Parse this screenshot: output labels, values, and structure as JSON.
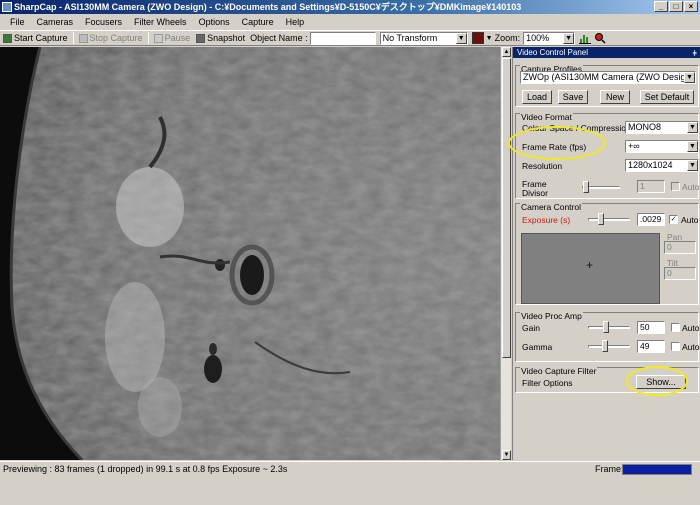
{
  "window": {
    "title": "SharpCap - ASI130MM Camera (ZWO Design) - C:¥Documents and Settings¥D-5150C¥デスクトップ¥DMKimage¥140103",
    "min": "_",
    "max": "□",
    "close": "×"
  },
  "menu": [
    "File",
    "Cameras",
    "Focusers",
    "Filter Wheels",
    "Options",
    "Capture",
    "Help"
  ],
  "toolbar": {
    "start_capture": "Start Capture",
    "stop_capture": "Stop Capture",
    "pause": "Pause",
    "snapshot": "Snapshot",
    "object_name_label": "Object Name :",
    "object_name_value": "",
    "transform_value": "No Transform",
    "zoom_label": "Zoom:",
    "zoom_value": "100%"
  },
  "panel": {
    "title": "Video Control Panel",
    "pin": "ǂ",
    "capture_profiles": {
      "label": "Capture Profiles",
      "profile": "ZWOp (ASI130MM Camera (ZWO Design))",
      "load": "Load",
      "save": "Save",
      "new": "New",
      "set_default": "Set Default"
    },
    "video_format": {
      "label": "Video Format",
      "colour_space_label": "Colour Space / Compression",
      "colour_space_value": "MONO8",
      "frame_rate_label": "Frame Rate (fps)",
      "frame_rate_value": "+∞",
      "resolution_label": "Resolution",
      "resolution_value": "1280x1024",
      "frame_divisor_label": "Frame Divisor",
      "frame_divisor_value": "1",
      "auto_label": "Auto"
    },
    "camera_control": {
      "label": "Camera Control",
      "exposure_label": "Exposure (s)",
      "exposure_value": ".0029",
      "auto_label": "Auto",
      "pan_label": "Pan",
      "pan_value": "0",
      "tilt_label": "Tilt",
      "tilt_value": "0",
      "crosshair": "+"
    },
    "video_proc_amp": {
      "label": "Video Proc Amp",
      "gain_label": "Gain",
      "gain_value": "50",
      "gamma_label": "Gamma",
      "gamma_value": "49",
      "auto_label": "Auto"
    },
    "video_capture_filter": {
      "label": "Video Capture Filter",
      "filter_options_label": "Filter Options",
      "show_button": "Show..."
    }
  },
  "status": {
    "text": "Previewing : 83 frames (1 dropped) in 99.1 s at 0.8 fps  Exposure ~ 2.3s",
    "frame_label": "Frame:"
  },
  "colors": {
    "titlebar": "#0a246a",
    "highlight": "#f3ea1a",
    "exposure_label": "#d01818",
    "frame_bar": "#0a1ea0"
  },
  "icons": [
    "sharpcap-app-icon",
    "start-capture-icon",
    "stop-capture-icon",
    "pause-icon",
    "snapshot-camera-icon",
    "color-swatch-icon",
    "histogram-icon",
    "focus-assist-icon"
  ]
}
